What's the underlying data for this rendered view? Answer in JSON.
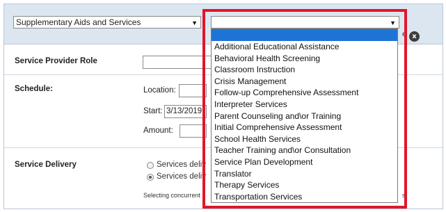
{
  "header": {
    "service_type_select": {
      "value": "Supplementary Aids and Services"
    },
    "service_select": {
      "value": ""
    },
    "close_label": "x",
    "partial_mark": "e"
  },
  "rows": {
    "provider_role": {
      "label": "Service Provider Role"
    },
    "schedule": {
      "label": "Schedule:",
      "location_label": "Location:",
      "start_label": "Start:",
      "start_value": "3/13/2019",
      "amount_label": "Amount:"
    },
    "service_delivery": {
      "label": "Service Delivery",
      "option_1": "Services deliv",
      "option_2": "Services deliv",
      "help_text_left": "Selecting concurrent",
      "help_text_right": "s."
    }
  },
  "dropdown": {
    "options": [
      "Additional Educational Assistance",
      "Behavioral Health Screening",
      "Classroom Instruction",
      "Crisis Management",
      "Follow-up Comprehensive Assessment",
      "Interpreter Services",
      "Parent Counseling and\\or Training",
      "Initial Comprehensive Assessment",
      "School Health Services",
      "Teacher Training and\\or Consultation",
      "Service Plan Development",
      "Translator",
      "Therapy Services",
      "Transportation Services"
    ]
  },
  "colors": {
    "highlight": "#e0162b",
    "selected_option": "#1e74d6",
    "header_band": "#dbe6f1"
  }
}
